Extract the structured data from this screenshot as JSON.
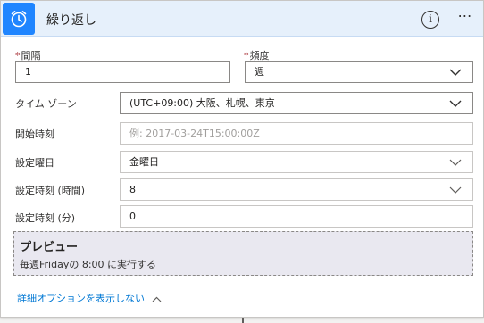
{
  "header": {
    "title": "繰り返し",
    "app_icon": "alarm-clock-icon",
    "info_icon": "i",
    "more_icon": "⋯",
    "accent_color": "#1f85ff"
  },
  "fields": {
    "interval": {
      "label": "間隔",
      "required": "*",
      "value": "1"
    },
    "frequency": {
      "label": "頻度",
      "required": "*",
      "value": "週"
    },
    "timezone": {
      "label": "タイム ゾーン",
      "value": "(UTC+09:00) 大阪、札幌、東京"
    },
    "start_time": {
      "label": "開始時刻",
      "placeholder": "例: 2017-03-24T15:00:00Z"
    },
    "weekdays": {
      "label": "設定曜日",
      "value": "金曜日"
    },
    "hours": {
      "label": "設定時刻 (時間)",
      "value": "8"
    },
    "minutes": {
      "label": "設定時刻 (分)",
      "value": "0"
    }
  },
  "preview": {
    "title": "プレビュー",
    "text": "毎週Fridayの 8:00 に実行する"
  },
  "advanced_link": "詳細オプションを表示しない"
}
